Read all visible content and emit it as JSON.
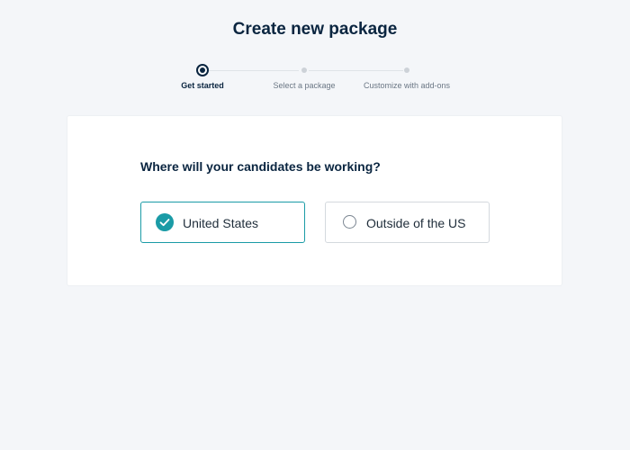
{
  "page": {
    "title": "Create new package"
  },
  "stepper": {
    "steps": [
      {
        "label": "Get started",
        "state": "active"
      },
      {
        "label": "Select a package",
        "state": "upcoming"
      },
      {
        "label": "Customize with add-ons",
        "state": "upcoming"
      }
    ]
  },
  "form": {
    "question": "Where will your candidates be working?",
    "options": [
      {
        "label": "United States",
        "selected": true,
        "icon": "check-circle-icon"
      },
      {
        "label": "Outside of the US",
        "selected": false,
        "icon": "radio-circle-icon"
      }
    ]
  },
  "colors": {
    "heading": "#0a2540",
    "accent": "#1a9ba6",
    "background": "#f4f6f9",
    "card": "#ffffff"
  }
}
